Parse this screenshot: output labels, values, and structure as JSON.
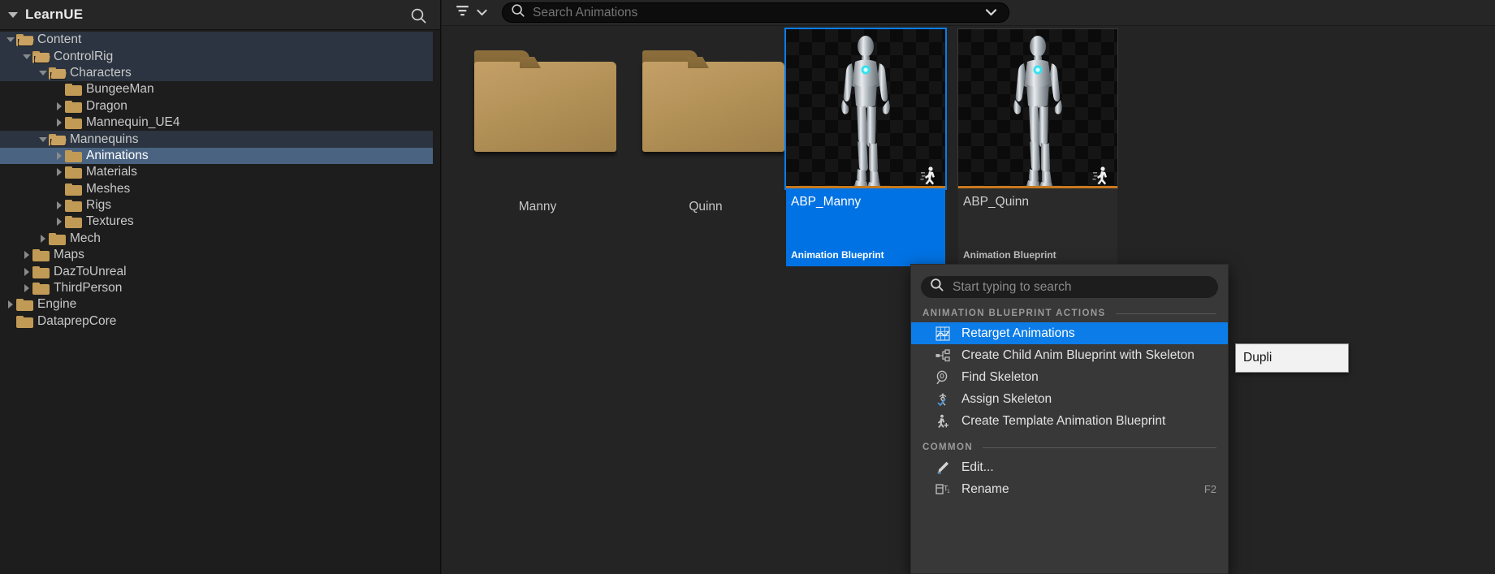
{
  "sidebar": {
    "header": {
      "title": "LearnUE",
      "search_icon": "search-icon",
      "collapse_icon": "caret-down-icon"
    },
    "items": [
      {
        "label": "Content",
        "depth": 0,
        "expander": "down",
        "open": true,
        "state": "light"
      },
      {
        "label": "ControlRig",
        "depth": 1,
        "expander": "down",
        "open": true,
        "state": "light"
      },
      {
        "label": "Characters",
        "depth": 2,
        "expander": "down",
        "open": true,
        "state": "light"
      },
      {
        "label": "BungeeMan",
        "depth": 3,
        "expander": "none",
        "open": false,
        "state": "none"
      },
      {
        "label": "Dragon",
        "depth": 3,
        "expander": "right",
        "open": false,
        "state": "none"
      },
      {
        "label": "Mannequin_UE4",
        "depth": 3,
        "expander": "right",
        "open": false,
        "state": "none"
      },
      {
        "label": "Mannequins",
        "depth": 2,
        "expander": "down",
        "open": true,
        "state": "light"
      },
      {
        "label": "Animations",
        "depth": 3,
        "expander": "right",
        "open": false,
        "state": "selected"
      },
      {
        "label": "Materials",
        "depth": 3,
        "expander": "right",
        "open": false,
        "state": "none"
      },
      {
        "label": "Meshes",
        "depth": 3,
        "expander": "none",
        "open": false,
        "state": "none"
      },
      {
        "label": "Rigs",
        "depth": 3,
        "expander": "right",
        "open": false,
        "state": "none"
      },
      {
        "label": "Textures",
        "depth": 3,
        "expander": "right",
        "open": false,
        "state": "none"
      },
      {
        "label": "Mech",
        "depth": 2,
        "expander": "right",
        "open": false,
        "state": "none"
      },
      {
        "label": "Maps",
        "depth": 1,
        "expander": "right",
        "open": false,
        "state": "none"
      },
      {
        "label": "DazToUnreal",
        "depth": 1,
        "expander": "right",
        "open": false,
        "state": "none"
      },
      {
        "label": "ThirdPerson",
        "depth": 1,
        "expander": "right",
        "open": false,
        "state": "none"
      },
      {
        "label": "Engine",
        "depth": 0,
        "expander": "right",
        "open": false,
        "state": "none"
      },
      {
        "label": "DataprepCore",
        "depth": 0,
        "expander": "none",
        "open": false,
        "state": "none"
      }
    ]
  },
  "content_browser": {
    "toolbar": {
      "filter_icon": "filter-icon",
      "filter_chevron_icon": "chevron-down-icon",
      "search_icon": "search-icon",
      "search_value": "",
      "search_placeholder": "Search Animations",
      "search_dropdown_icon": "chevron-down-icon"
    },
    "assets": [
      {
        "name": "Manny",
        "kind": "folder",
        "selected": false
      },
      {
        "name": "Quinn",
        "kind": "folder",
        "selected": false
      },
      {
        "name": "ABP_Manny",
        "kind": "asset",
        "type_label": "Animation Blueprint",
        "selected": true,
        "badge_icon": "anim-blueprint-badge-icon"
      },
      {
        "name": "ABP_Quinn",
        "kind": "asset",
        "type_label": "Animation Blueprint",
        "selected": false,
        "badge_icon": "anim-blueprint-badge-icon"
      }
    ]
  },
  "context_menu": {
    "search_placeholder": "Start typing to search",
    "search_value": "",
    "search_icon": "search-icon",
    "sections": [
      {
        "title": "ANIMATION BLUEPRINT ACTIONS",
        "items": [
          {
            "label": "Retarget Animations",
            "icon": "retarget-animations-icon",
            "active": true,
            "shortcut": ""
          },
          {
            "label": "Create Child Anim Blueprint with Skeleton",
            "icon": "child-blueprint-icon",
            "active": false,
            "shortcut": ""
          },
          {
            "label": "Find Skeleton",
            "icon": "find-skeleton-icon",
            "active": false,
            "shortcut": ""
          },
          {
            "label": "Assign Skeleton",
            "icon": "assign-skeleton-icon",
            "active": false,
            "shortcut": ""
          },
          {
            "label": "Create Template Animation Blueprint",
            "icon": "template-blueprint-icon",
            "active": false,
            "shortcut": ""
          }
        ]
      },
      {
        "title": "COMMON",
        "items": [
          {
            "label": "Edit...",
            "icon": "edit-pencil-icon",
            "active": false,
            "shortcut": ""
          },
          {
            "label": "Rename",
            "icon": "rename-icon",
            "active": false,
            "shortcut": "F2"
          }
        ]
      }
    ]
  },
  "tooltip": {
    "text": "Dupli"
  },
  "colors": {
    "selection_blue": "#0072e3",
    "menu_highlight_blue": "#0b7ce8",
    "folder_amber": "#c19a55",
    "tile_accent_orange": "#c8791e",
    "tree_selected": "#4a6380",
    "tree_highlight": "#2b3440",
    "panel_bg": "#1d1d1d",
    "browser_bg": "#242424",
    "menu_bg": "#383838"
  }
}
